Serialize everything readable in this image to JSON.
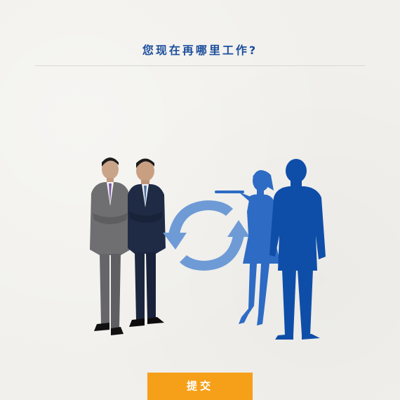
{
  "question": {
    "title": "您现在再哪里工作?"
  },
  "illustration": {
    "left_group": "two-businessmen-photo",
    "swap_icon": "refresh-arrows-icon",
    "right_group": "service-staff-silhouettes"
  },
  "actions": {
    "submit_label": "提交"
  },
  "colors": {
    "title": "#1d4f9c",
    "accent_button": "#f6a01a",
    "arrows": "#6e9bd6",
    "silhouette_woman": "#2d6bc4",
    "silhouette_man": "#0f4ea8"
  }
}
